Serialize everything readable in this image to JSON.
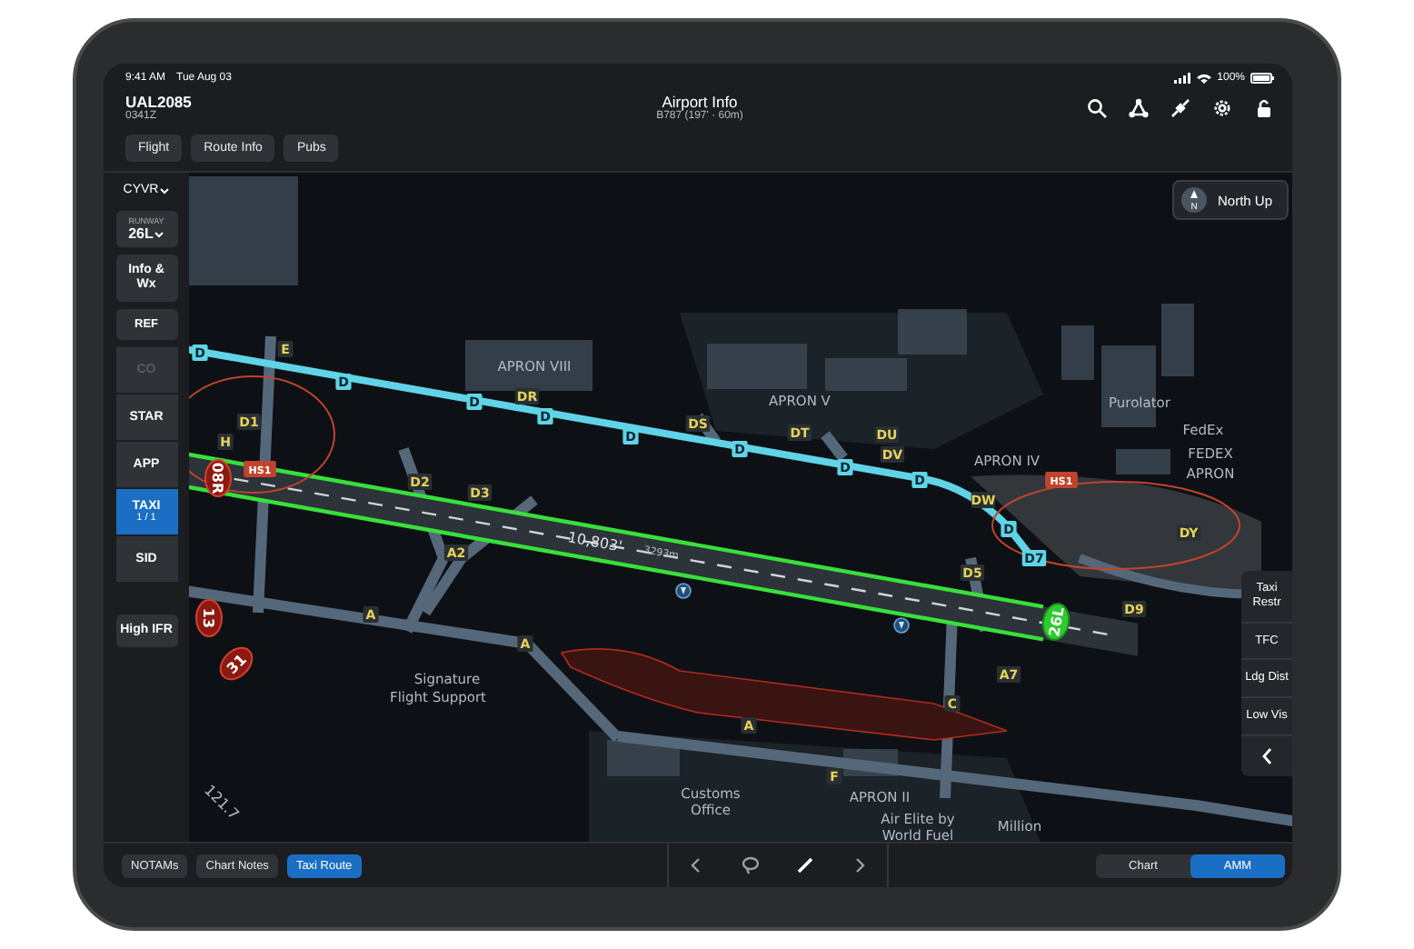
{
  "status_bar": {
    "time": "9:41 AM",
    "date": "Tue Aug 03",
    "battery": "100%"
  },
  "header": {
    "flight": "UAL2085",
    "time": "0341Z",
    "title": "Airport Info",
    "subtitle": "B787 (197' · 60m)"
  },
  "tabs": [
    {
      "label": "Flight"
    },
    {
      "label": "Route Info"
    },
    {
      "label": "Pubs"
    }
  ],
  "sidebar": {
    "airport": "CYVR",
    "runway_label": "RUNWAY",
    "runway": "26L",
    "items": [
      {
        "label": "Info & Wx",
        "selected": false,
        "disabled": false
      },
      {
        "label": "REF",
        "selected": false,
        "disabled": false
      },
      {
        "label": "CO",
        "selected": false,
        "disabled": true
      },
      {
        "label": "STAR",
        "selected": false,
        "disabled": false
      },
      {
        "label": "APP",
        "selected": false,
        "disabled": false
      },
      {
        "label": "TAXI",
        "sublabel": "1 / 1",
        "selected": true,
        "disabled": false
      },
      {
        "label": "SID",
        "selected": false,
        "disabled": false
      },
      {
        "label": "High IFR",
        "selected": false,
        "disabled": false
      }
    ]
  },
  "orientation_button": {
    "label": "North Up",
    "letter": "N"
  },
  "map": {
    "labels": [
      {
        "text": "APRON VIII",
        "kind": "area"
      },
      {
        "text": "APRON V",
        "kind": "area"
      },
      {
        "text": "APRON IV",
        "kind": "area"
      },
      {
        "text": "Purolator",
        "kind": "area"
      },
      {
        "text": "FedEx",
        "kind": "area"
      },
      {
        "text": "FEDEX",
        "kind": "area"
      },
      {
        "text": "APRON",
        "kind": "area"
      },
      {
        "text": "Signature",
        "kind": "area"
      },
      {
        "text": "Flight Support",
        "kind": "area"
      },
      {
        "text": "Customs",
        "kind": "area"
      },
      {
        "text": "Office",
        "kind": "area"
      },
      {
        "text": "APRON II",
        "kind": "area"
      },
      {
        "text": "Air Elite by",
        "kind": "area"
      },
      {
        "text": "World Fuel",
        "kind": "area"
      },
      {
        "text": "Million",
        "kind": "area"
      },
      {
        "text": "D",
        "kind": "route"
      },
      {
        "text": "D",
        "kind": "route"
      },
      {
        "text": "D",
        "kind": "route"
      },
      {
        "text": "D",
        "kind": "route"
      },
      {
        "text": "D",
        "kind": "route"
      },
      {
        "text": "D",
        "kind": "route"
      },
      {
        "text": "D",
        "kind": "route"
      },
      {
        "text": "D",
        "kind": "route"
      },
      {
        "text": "D",
        "kind": "route"
      },
      {
        "text": "D7",
        "kind": "route"
      },
      {
        "text": "DR",
        "kind": "taxiway"
      },
      {
        "text": "DS",
        "kind": "taxiway"
      },
      {
        "text": "DT",
        "kind": "taxiway"
      },
      {
        "text": "DU",
        "kind": "taxiway"
      },
      {
        "text": "DV",
        "kind": "taxiway"
      },
      {
        "text": "DW",
        "kind": "taxiway"
      },
      {
        "text": "D5",
        "kind": "taxiway"
      },
      {
        "text": "D9",
        "kind": "taxiway"
      },
      {
        "text": "DY",
        "kind": "taxiway"
      },
      {
        "text": "D1",
        "kind": "taxiway"
      },
      {
        "text": "D2",
        "kind": "taxiway"
      },
      {
        "text": "D3",
        "kind": "taxiway"
      },
      {
        "text": "A2",
        "kind": "taxiway"
      },
      {
        "text": "A7",
        "kind": "taxiway"
      },
      {
        "text": "A",
        "kind": "taxiway"
      },
      {
        "text": "A",
        "kind": "taxiway"
      },
      {
        "text": "A",
        "kind": "taxiway"
      },
      {
        "text": "E",
        "kind": "taxiway"
      },
      {
        "text": "H",
        "kind": "taxiway"
      },
      {
        "text": "C",
        "kind": "taxiway"
      },
      {
        "text": "F",
        "kind": "taxiway"
      },
      {
        "text": "HS1",
        "kind": "hotspot"
      },
      {
        "text": "HS1",
        "kind": "hotspot"
      },
      {
        "text": "08R",
        "kind": "runway_end"
      },
      {
        "text": "26L",
        "kind": "runway_end_active"
      },
      {
        "text": "13",
        "kind": "runway_end"
      },
      {
        "text": "31",
        "kind": "runway_end"
      },
      {
        "text": "10,803'",
        "kind": "length"
      },
      {
        "text": "3293m",
        "kind": "length_small"
      },
      {
        "text": "121.7",
        "kind": "frequency"
      }
    ]
  },
  "right_panel": [
    {
      "label": "Taxi Restr"
    },
    {
      "label": "TFC"
    },
    {
      "label": "Ldg Dist"
    },
    {
      "label": "Low Vis"
    }
  ],
  "bottom_bar": {
    "buttons": [
      {
        "label": "NOTAMs",
        "selected": false
      },
      {
        "label": "Chart Notes",
        "selected": false
      },
      {
        "label": "Taxi Route",
        "selected": true
      }
    ],
    "view_toggle": [
      {
        "label": "Chart",
        "selected": false
      },
      {
        "label": "AMM",
        "selected": true
      }
    ]
  }
}
